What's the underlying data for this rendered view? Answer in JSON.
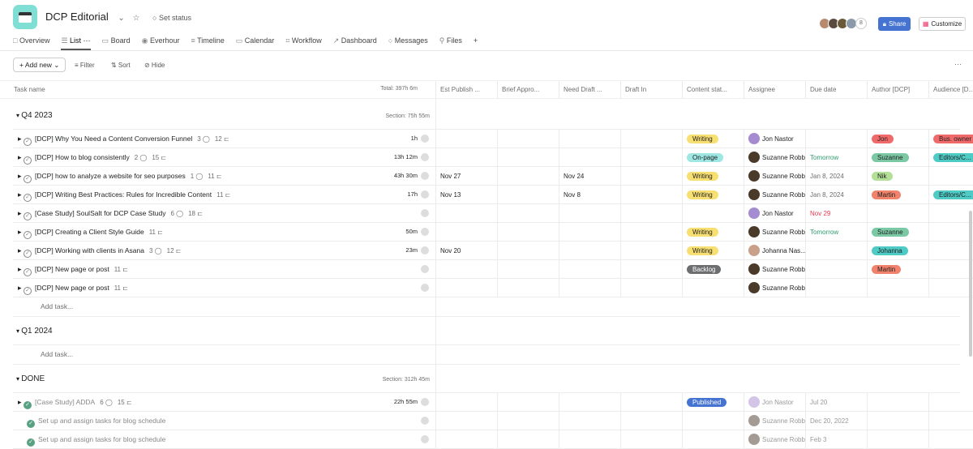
{
  "project": {
    "title": "DCP Editorial",
    "set_status": "Set status",
    "member_count": "8",
    "share": "Share",
    "customize": "Customize",
    "more": "···"
  },
  "tabs": [
    {
      "label": "Overview",
      "icon": "□"
    },
    {
      "label": "List",
      "icon": "☰",
      "active": true,
      "more": "···"
    },
    {
      "label": "Board",
      "icon": "▭"
    },
    {
      "label": "Everhour",
      "icon": "◉"
    },
    {
      "label": "Timeline",
      "icon": "≡"
    },
    {
      "label": "Calendar",
      "icon": "▭"
    },
    {
      "label": "Workflow",
      "icon": "⌗"
    },
    {
      "label": "Dashboard",
      "icon": "↗"
    },
    {
      "label": "Messages",
      "icon": "○"
    },
    {
      "label": "Files",
      "icon": "⚲"
    },
    {
      "label": "+",
      "icon": ""
    }
  ],
  "toolbar": {
    "add_new": "+ Add new ⌄",
    "filter": "≡ Filter",
    "sort": "⇅ Sort",
    "hide": "⊘ Hide"
  },
  "columns": {
    "task_name": "Task name",
    "total": "Total: 397h 6m",
    "cols": [
      "Est Publish ...",
      "Brief Appro...",
      "Need Draft ...",
      "Draft In",
      "Content stat...",
      "Assignee",
      "Due date",
      "Author [DCP]",
      "Audience [D..."
    ]
  },
  "colors": {
    "Writing": "#f8df72",
    "On-page": "#9ee7e3",
    "Backlog": "#6d6e6f",
    "Published": "#4573d2",
    "Jon": "#f06a6a",
    "Suzanne": "#7bc9a4",
    "Nik": "#b3df97",
    "Martin": "#f1836c",
    "Johanna": "#4ecbc4",
    "Bus. owner": "#f06a6a",
    "Editors/C...": "#4ecbc4"
  },
  "sections": [
    {
      "name": "Q4 2023",
      "time": "Section: 75h 55m",
      "add_task": "Add task...",
      "tasks": [
        {
          "name": "[DCP] Why You Need a Content Conversion Funnel",
          "comments": "3",
          "subtasks": "12",
          "time": "1h",
          "est": "",
          "need": "",
          "status": "Writing",
          "assignee": "Jon Nastor",
          "due": "",
          "author": "Jon",
          "audience": "Bus. owner"
        },
        {
          "name": "[DCP] How to blog consistently",
          "comments": "2",
          "subtasks": "15",
          "time": "13h 12m",
          "est": "",
          "need": "",
          "status": "On-page",
          "assignee": "Suzanne Robb",
          "due": "Tomorrow",
          "due_color": "#2e9e6e",
          "author": "Suzanne",
          "audience": "Editors/C..."
        },
        {
          "name": "[DCP] how to analyze a website for seo purposes",
          "comments": "1",
          "subtasks": "11",
          "time": "43h 30m",
          "est": "Nov 27",
          "need": "Nov 24",
          "status": "Writing",
          "assignee": "Suzanne Robb",
          "due": "Jan 8, 2024",
          "author": "Nik",
          "audience": ""
        },
        {
          "name": "[DCP] Writing Best Practices: Rules for Incredible Content",
          "comments": "",
          "subtasks": "11",
          "time": "17h",
          "est": "Nov 13",
          "need": "Nov 8",
          "status": "Writing",
          "assignee": "Suzanne Robb",
          "due": "Jan 8, 2024",
          "author": "Martin",
          "audience": "Editors/C..."
        },
        {
          "name": "[Case Study] SoulSalt for DCP Case Study",
          "comments": "6",
          "subtasks": "18",
          "time": "",
          "est": "",
          "need": "",
          "status": "",
          "assignee": "Jon Nastor",
          "due": "Nov 29",
          "due_color": "#e8384f",
          "author": "",
          "audience": ""
        },
        {
          "name": "[DCP] Creating a Client Style Guide",
          "comments": "",
          "subtasks": "11",
          "time": "50m",
          "est": "",
          "need": "",
          "status": "Writing",
          "assignee": "Suzanne Robb",
          "due": "Tomorrow",
          "due_color": "#2e9e6e",
          "author": "Suzanne",
          "audience": ""
        },
        {
          "name": "[DCP] Working with clients in Asana",
          "comments": "3",
          "subtasks": "12",
          "time": "23m",
          "est": "Nov 20",
          "need": "",
          "status": "Writing",
          "assignee": "Johanna Nas...",
          "due": "",
          "author": "Johanna",
          "audience": ""
        },
        {
          "name": "[DCP] New page or post",
          "comments": "",
          "subtasks": "11",
          "time": "",
          "est": "",
          "need": "",
          "status": "Backlog",
          "assignee": "Suzanne Robb",
          "due": "",
          "author": "Martin",
          "audience": ""
        },
        {
          "name": "[DCP] New page or post",
          "comments": "",
          "subtasks": "11",
          "time": "",
          "est": "",
          "need": "",
          "status": "",
          "assignee": "Suzanne Robb",
          "due": "",
          "author": "",
          "audience": ""
        }
      ]
    },
    {
      "name": "Q1 2024",
      "time": "",
      "add_task": "Add task...",
      "tasks": []
    },
    {
      "name": "DONE",
      "time": "Section: 312h 45m",
      "tasks": [
        {
          "name": "[Case Study] ADDA",
          "comments": "6",
          "subtasks": "15",
          "time": "22h 55m",
          "done": true,
          "expand": true,
          "status": "Published",
          "assignee": "Jon Nastor",
          "due": "Jul 20"
        },
        {
          "name": "Set up and assign tasks for blog schedule",
          "done": true,
          "expand": false,
          "status": "",
          "assignee": "Suzanne Robb",
          "due": "Dec 20, 2022"
        },
        {
          "name": "Set up and assign tasks for blog schedule",
          "done": true,
          "expand": false,
          "status": "",
          "assignee": "Suzanne Robb",
          "due": "Feb 3"
        }
      ]
    }
  ]
}
